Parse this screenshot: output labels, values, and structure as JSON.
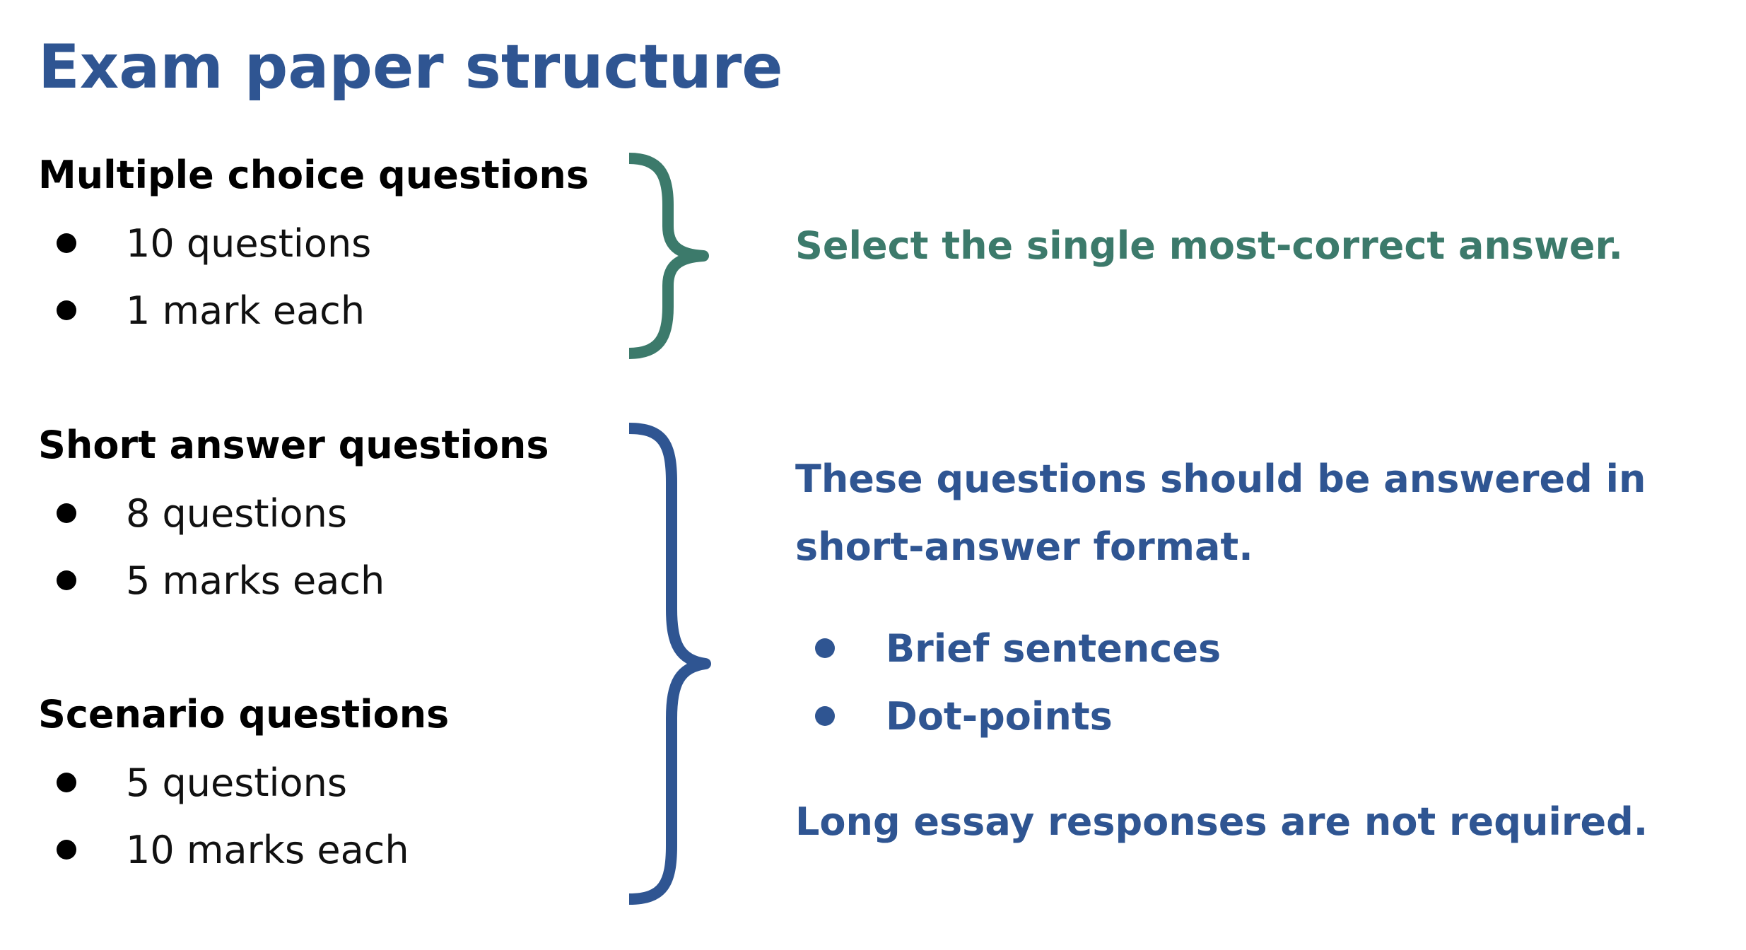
{
  "title": "Exam paper structure",
  "sections": [
    {
      "heading": "Multiple choice questions",
      "bullets": [
        "10 questions",
        "1 mark each"
      ]
    },
    {
      "heading": "Short answer questions",
      "bullets": [
        "8 questions",
        "5 marks each"
      ]
    },
    {
      "heading": "Scenario questions",
      "bullets": [
        "5 questions",
        "10 marks each"
      ]
    }
  ],
  "notes": {
    "multiple_choice": "Select the single most-correct answer.",
    "written_line1": "These questions should be answered in",
    "written_line2": "short-answer format.",
    "written_bullets": [
      "Brief sentences",
      "Dot-points"
    ],
    "written_closing": "Long essay responses are not required."
  },
  "colors": {
    "title": "#2f5592",
    "green_brace": "#3c7a6b",
    "blue_brace": "#2f5592",
    "body_text": "#000000"
  },
  "icons": {
    "multiple_choice_brace": "right-curly-brace-icon",
    "written_brace": "right-curly-brace-icon",
    "bullet": "filled-circle-bullet-icon"
  }
}
